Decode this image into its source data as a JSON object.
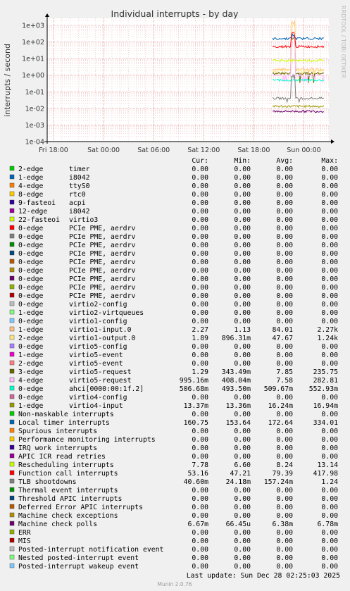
{
  "title": "Individual interrupts - by day",
  "watermark": "RRDTOOL / TOBI OETIKER",
  "footer_version": "Munin 2.0.76",
  "last_update": "Last update: Sun Dec 28 02:25:03 2025",
  "legend_headers": {
    "cur": "Cur:",
    "min": "Min:",
    "avg": "Avg:",
    "max": "Max:"
  },
  "chart_data": {
    "type": "line",
    "title": "Individual interrupts - by day",
    "ylabel": "interrupts / second",
    "y_scale": "log",
    "ylim": [
      0.0001,
      1000
    ],
    "y_ticks": [
      "1e-04",
      "1e-03",
      "1e-02",
      "1e-01",
      "1e+00",
      "1e+01",
      "1e+02",
      "1e+03"
    ],
    "x_ticks": [
      "Fri 18:00",
      "Sat 00:00",
      "Sat 06:00",
      "Sat 12:00",
      "Sat 18:00",
      "Sun 00:00"
    ],
    "grid": true,
    "data_window": "Sat 20:15 – Sun 02:25",
    "series": [
      {
        "color": "#00cc00",
        "label": "2-edge",
        "desc": "timer",
        "cur": "0.00",
        "min": "0.00",
        "avg": "0.00",
        "max": "0.00"
      },
      {
        "color": "#0066b3",
        "label": "1-edge",
        "desc": "i8042",
        "cur": "0.00",
        "min": "0.00",
        "avg": "0.00",
        "max": "0.00"
      },
      {
        "color": "#ff8000",
        "label": "4-edge",
        "desc": "ttyS0",
        "cur": "0.00",
        "min": "0.00",
        "avg": "0.00",
        "max": "0.00"
      },
      {
        "color": "#ffcc00",
        "label": "8-edge",
        "desc": "rtc0",
        "cur": "0.00",
        "min": "0.00",
        "avg": "0.00",
        "max": "0.00"
      },
      {
        "color": "#330099",
        "label": "9-fasteoi",
        "desc": "acpi",
        "cur": "0.00",
        "min": "0.00",
        "avg": "0.00",
        "max": "0.00"
      },
      {
        "color": "#990099",
        "label": "12-edge",
        "desc": "i8042",
        "cur": "0.00",
        "min": "0.00",
        "avg": "0.00",
        "max": "0.00"
      },
      {
        "color": "#ccff00",
        "label": "22-fasteoi",
        "desc": "virtio3",
        "cur": "0.00",
        "min": "0.00",
        "avg": "0.00",
        "max": "0.00"
      },
      {
        "color": "#ff0000",
        "label": "0-edge",
        "desc": "PCIe PME, aerdrv",
        "cur": "0.00",
        "min": "0.00",
        "avg": "0.00",
        "max": "0.00"
      },
      {
        "color": "#808080",
        "label": "0-edge",
        "desc": "PCIe PME, aerdrv",
        "cur": "0.00",
        "min": "0.00",
        "avg": "0.00",
        "max": "0.00"
      },
      {
        "color": "#008f00",
        "label": "0-edge",
        "desc": "PCIe PME, aerdrv",
        "cur": "0.00",
        "min": "0.00",
        "avg": "0.00",
        "max": "0.00"
      },
      {
        "color": "#00487d",
        "label": "0-edge",
        "desc": "PCIe PME, aerdrv",
        "cur": "0.00",
        "min": "0.00",
        "avg": "0.00",
        "max": "0.00"
      },
      {
        "color": "#b35a00",
        "label": "0-edge",
        "desc": "PCIe PME, aerdrv",
        "cur": "0.00",
        "min": "0.00",
        "avg": "0.00",
        "max": "0.00"
      },
      {
        "color": "#b38f00",
        "label": "0-edge",
        "desc": "PCIe PME, aerdrv",
        "cur": "0.00",
        "min": "0.00",
        "avg": "0.00",
        "max": "0.00"
      },
      {
        "color": "#6b006b",
        "label": "0-edge",
        "desc": "PCIe PME, aerdrv",
        "cur": "0.00",
        "min": "0.00",
        "avg": "0.00",
        "max": "0.00"
      },
      {
        "color": "#8fb300",
        "label": "0-edge",
        "desc": "PCIe PME, aerdrv",
        "cur": "0.00",
        "min": "0.00",
        "avg": "0.00",
        "max": "0.00"
      },
      {
        "color": "#b30000",
        "label": "0-edge",
        "desc": "PCIe PME, aerdrv",
        "cur": "0.00",
        "min": "0.00",
        "avg": "0.00",
        "max": "0.00"
      },
      {
        "color": "#bebebe",
        "label": "0-edge",
        "desc": "virtio2-config",
        "cur": "0.00",
        "min": "0.00",
        "avg": "0.00",
        "max": "0.00"
      },
      {
        "color": "#80ff80",
        "label": "1-edge",
        "desc": "virtio2-virtqueues",
        "cur": "0.00",
        "min": "0.00",
        "avg": "0.00",
        "max": "0.00"
      },
      {
        "color": "#80c9ff",
        "label": "0-edge",
        "desc": "virtio1-config",
        "cur": "0.00",
        "min": "0.00",
        "avg": "0.00",
        "max": "0.00"
      },
      {
        "color": "#ffc080",
        "label": "1-edge",
        "desc": "virtio1-input.0",
        "cur": "2.27",
        "min": "1.13",
        "avg": "84.01",
        "max": "2.27k"
      },
      {
        "color": "#ffe680",
        "label": "2-edge",
        "desc": "virtio1-output.0",
        "cur": "1.89",
        "min": "896.31m",
        "avg": "47.67",
        "max": "1.24k"
      },
      {
        "color": "#aa80ff",
        "label": "0-edge",
        "desc": "virtio5-config",
        "cur": "0.00",
        "min": "0.00",
        "avg": "0.00",
        "max": "0.00"
      },
      {
        "color": "#ee00cc",
        "label": "1-edge",
        "desc": "virtio5-event",
        "cur": "0.00",
        "min": "0.00",
        "avg": "0.00",
        "max": "0.00"
      },
      {
        "color": "#ff8080",
        "label": "2-edge",
        "desc": "virtio5-event",
        "cur": "0.00",
        "min": "0.00",
        "avg": "0.00",
        "max": "0.00"
      },
      {
        "color": "#666600",
        "label": "3-edge",
        "desc": "virtio5-request",
        "cur": "1.29",
        "min": "343.49m",
        "avg": "7.85",
        "max": "235.75"
      },
      {
        "color": "#ffbfff",
        "label": "4-edge",
        "desc": "virtio5-request",
        "cur": "995.16m",
        "min": "408.04m",
        "avg": "7.58",
        "max": "282.81"
      },
      {
        "color": "#00ffcc",
        "label": "0-edge",
        "desc": "ahci[0000:00:1f.2]",
        "cur": "506.68m",
        "min": "493.50m",
        "avg": "509.67m",
        "max": "552.93m"
      },
      {
        "color": "#cc6699",
        "label": "0-edge",
        "desc": "virtio4-config",
        "cur": "0.00",
        "min": "0.00",
        "avg": "0.00",
        "max": "0.00"
      },
      {
        "color": "#999900",
        "label": "1-edge",
        "desc": "virtio4-input",
        "cur": "13.37m",
        "min": "13.36m",
        "avg": "16.24m",
        "max": "16.94m"
      },
      {
        "color": "#00cc00",
        "label": "Non-maskable interrupts",
        "desc": "",
        "cur": "0.00",
        "min": "0.00",
        "avg": "0.00",
        "max": "0.00"
      },
      {
        "color": "#0066b3",
        "label": "Local timer interrupts",
        "desc": "",
        "cur": "160.75",
        "min": "153.64",
        "avg": "172.64",
        "max": "334.01"
      },
      {
        "color": "#ff8000",
        "label": "Spurious interrupts",
        "desc": "",
        "cur": "0.00",
        "min": "0.00",
        "avg": "0.00",
        "max": "0.00"
      },
      {
        "color": "#ffcc00",
        "label": "Performance monitoring interrupts",
        "desc": "",
        "cur": "0.00",
        "min": "0.00",
        "avg": "0.00",
        "max": "0.00"
      },
      {
        "color": "#330099",
        "label": "IRQ work interrupts",
        "desc": "",
        "cur": "0.00",
        "min": "0.00",
        "avg": "0.00",
        "max": "0.00"
      },
      {
        "color": "#990099",
        "label": "APIC ICR read retries",
        "desc": "",
        "cur": "0.00",
        "min": "0.00",
        "avg": "0.00",
        "max": "0.00"
      },
      {
        "color": "#ccff00",
        "label": "Rescheduling interrupts",
        "desc": "",
        "cur": "7.78",
        "min": "6.60",
        "avg": "8.24",
        "max": "13.14"
      },
      {
        "color": "#ff0000",
        "label": "Function call interrupts",
        "desc": "",
        "cur": "53.16",
        "min": "47.21",
        "avg": "79.39",
        "max": "417.98"
      },
      {
        "color": "#808080",
        "label": "TLB shootdowns",
        "desc": "",
        "cur": "40.60m",
        "min": "24.18m",
        "avg": "157.24m",
        "max": "1.24"
      },
      {
        "color": "#008f00",
        "label": "Thermal event interrupts",
        "desc": "",
        "cur": "0.00",
        "min": "0.00",
        "avg": "0.00",
        "max": "0.00"
      },
      {
        "color": "#00487d",
        "label": "Threshold APIC interrupts",
        "desc": "",
        "cur": "0.00",
        "min": "0.00",
        "avg": "0.00",
        "max": "0.00"
      },
      {
        "color": "#b35a00",
        "label": "Deferred Error APIC interrupts",
        "desc": "",
        "cur": "0.00",
        "min": "0.00",
        "avg": "0.00",
        "max": "0.00"
      },
      {
        "color": "#b38f00",
        "label": "Machine check exceptions",
        "desc": "",
        "cur": "0.00",
        "min": "0.00",
        "avg": "0.00",
        "max": "0.00"
      },
      {
        "color": "#6b006b",
        "label": "Machine check polls",
        "desc": "",
        "cur": "6.67m",
        "min": "66.45u",
        "avg": "6.38m",
        "max": "6.78m"
      },
      {
        "color": "#8fb300",
        "label": "ERR",
        "desc": "",
        "cur": "0.00",
        "min": "0.00",
        "avg": "0.00",
        "max": "0.00"
      },
      {
        "color": "#b30000",
        "label": "MIS",
        "desc": "",
        "cur": "0.00",
        "min": "0.00",
        "avg": "0.00",
        "max": "0.00"
      },
      {
        "color": "#bebebe",
        "label": "Posted-interrupt notification event",
        "desc": "",
        "cur": "0.00",
        "min": "0.00",
        "avg": "0.00",
        "max": "0.00"
      },
      {
        "color": "#80ff80",
        "label": "Nested posted-interrupt event",
        "desc": "",
        "cur": "0.00",
        "min": "0.00",
        "avg": "0.00",
        "max": "0.00"
      },
      {
        "color": "#80c9ff",
        "label": "Posted-interrupt wakeup event",
        "desc": "",
        "cur": "0.00",
        "min": "0.00",
        "avg": "0.00",
        "max": "0.00"
      }
    ]
  }
}
